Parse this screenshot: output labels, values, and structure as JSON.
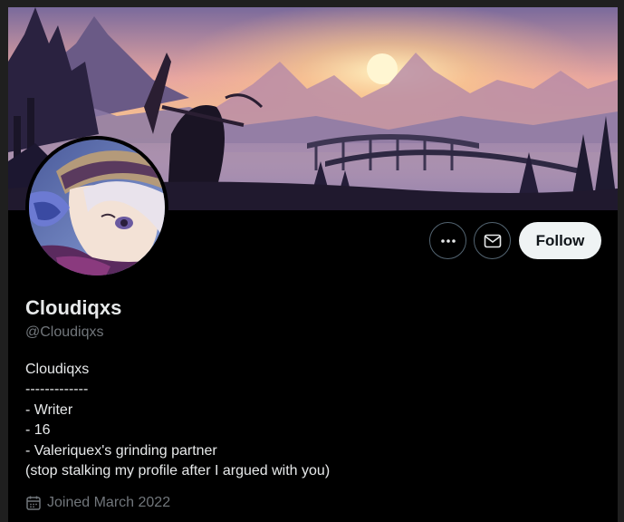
{
  "profile": {
    "display_name": "Cloudiqxs",
    "handle": "@Cloudiqxs",
    "bio_lines": [
      "Cloudiqxs",
      "-------------",
      "- Writer",
      "- 16",
      "- Valeriquex's grinding partner",
      "(stop stalking my profile after I argued with you)"
    ],
    "joined": "Joined March 2022"
  },
  "actions": {
    "more_icon": "more-horizontal-icon",
    "message_icon": "envelope-icon",
    "follow_label": "Follow"
  },
  "icons": {
    "joined_icon": "calendar-icon"
  },
  "colors": {
    "background": "#000000",
    "primary_text": "#e7e9ea",
    "secondary_text": "#71767b",
    "button_border": "#536471",
    "follow_bg": "#eff3f4",
    "follow_text": "#0f1419"
  }
}
